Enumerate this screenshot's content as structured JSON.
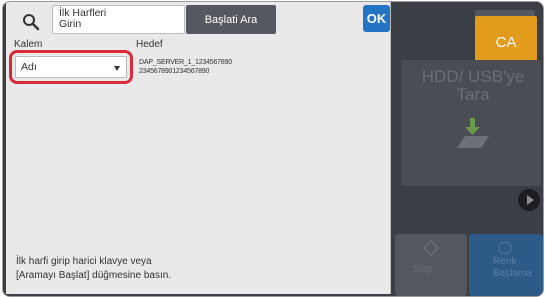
{
  "search": {
    "button_icon": "search-icon",
    "input_line1": "İlk Harfleri",
    "input_line2": "Girin",
    "start_label": "Başlati Ara",
    "ok_label": "OK"
  },
  "columns": {
    "kalem": "Kalem",
    "hedef": "Hedef"
  },
  "kalem_dropdown": {
    "selected": "Adı"
  },
  "destination": {
    "line1": "DAP_SERVER_1_1234567890",
    "line2": "2345678901234567890"
  },
  "help": {
    "line1": "İlk harfi girip harici klavye veya",
    "line2": "[Aramayı Başlat] düğmesine basın."
  },
  "background": {
    "ca_label": "CA",
    "hdd_label_line1": "HDD/ USB'ye",
    "hdd_label_line2": "Tara",
    "stop_label": "Stop",
    "color_label_line1": "Renk",
    "color_label_line2": "Başlama"
  },
  "colors": {
    "ok_blue": "#2574c4",
    "ca_orange": "#e39b1c",
    "highlight_red": "#d92a3b",
    "start_button_gray": "#55585e"
  }
}
